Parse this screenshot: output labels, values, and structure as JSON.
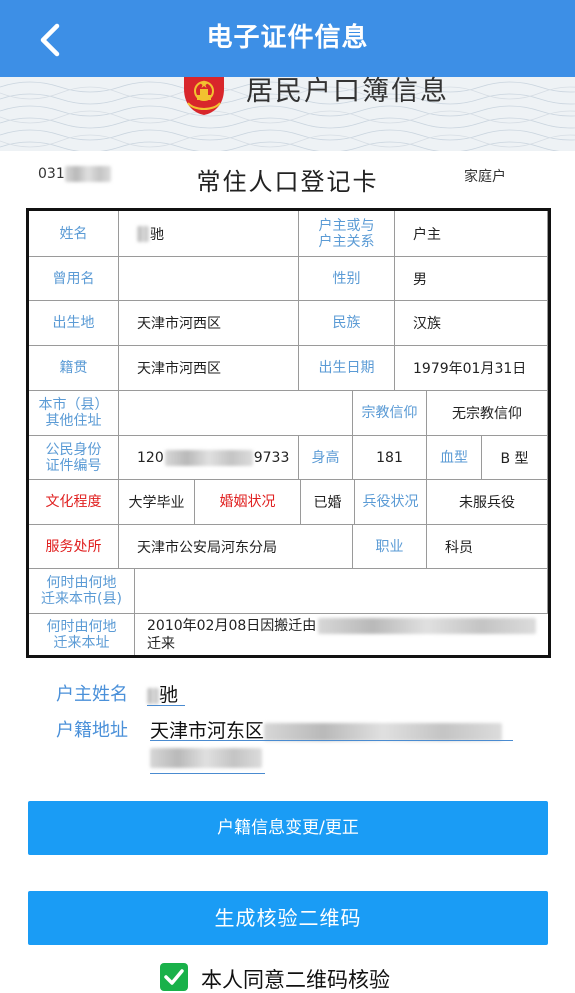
{
  "header": {
    "title": "电子证件信息",
    "back_icon": "chevron-left-icon"
  },
  "banner": {
    "title": "居民户口簿信息",
    "emblem_icon": "national-emblem-icon"
  },
  "card": {
    "number_prefix": "031",
    "title": "常住人口登记卡",
    "type": "家庭户"
  },
  "table": {
    "name_label": "姓名",
    "name_value": "驰",
    "relation_label_1": "户主或与",
    "relation_label_2": "户主关系",
    "relation_value": "户主",
    "former_name_label": "曾用名",
    "former_name_value": "",
    "gender_label": "性别",
    "gender_value": "男",
    "birthplace_label": "出生地",
    "birthplace_value": "天津市河西区",
    "ethnicity_label": "民族",
    "ethnicity_value": "汉族",
    "native_place_label": "籍贯",
    "native_place_value": "天津市河西区",
    "birthdate_label": "出生日期",
    "birthdate_value": "1979年01月31日",
    "other_address_label_1": "本市（县）",
    "other_address_label_2": "其他住址",
    "other_address_value": "",
    "religion_label": "宗教信仰",
    "religion_value": "无宗教信仰",
    "id_label_1": "公民身份",
    "id_label_2": "证件编号",
    "id_prefix": "120",
    "id_suffix": "9733",
    "height_label": "身高",
    "height_value": "181",
    "blood_label": "血型",
    "blood_value": "B 型",
    "education_label": "文化程度",
    "education_value": "大学毕业",
    "marital_label": "婚姻状况",
    "marital_value": "已婚",
    "military_label": "兵役状况",
    "military_value": "未服兵役",
    "office_label": "服务处所",
    "office_value": "天津市公安局河东分局",
    "job_label": "职业",
    "job_value": "科员",
    "moved_city_label_1": "何时由何地",
    "moved_city_label_2": "迁来本市(县)",
    "moved_city_value": "",
    "moved_addr_label_1": "何时由何地",
    "moved_addr_label_2": "迁来本址",
    "moved_addr_value_1": "2010年02月08日因搬迁由",
    "moved_addr_value_2": "迁来"
  },
  "fields": {
    "head_name_label": "户主姓名",
    "head_name_value": "驰",
    "address_label": "户籍地址",
    "address_value": "天津市河东区"
  },
  "buttons": {
    "change": "户籍信息变更/更正",
    "qr": "生成核验二维码"
  },
  "consent": {
    "text": "本人同意二维码核验",
    "checked": true
  },
  "colors": {
    "header": "#3d8fe6",
    "button": "#1a9cf5",
    "label_blue": "#5b9bd5",
    "label_red": "#e02020",
    "check": "#19b14a"
  }
}
